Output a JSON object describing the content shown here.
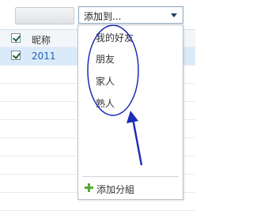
{
  "toolbar": {
    "dropdown_value": "添加到..."
  },
  "table": {
    "header_label": "昵称",
    "row_value": "2011"
  },
  "menu": {
    "items": [
      "我的好友",
      "朋友",
      "家人",
      "熟人"
    ],
    "footer_label": "添加分組"
  },
  "colors": {
    "annotation": "#1c2bb8",
    "add_icon": "#5aaa2f",
    "selected_row": "#dbeaf8"
  }
}
